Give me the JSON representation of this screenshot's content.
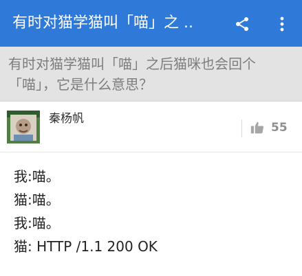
{
  "topbar": {
    "title": "有时对猫学猫叫「喵」之 ..",
    "share_icon": "share-icon",
    "more_icon": "more-vertical-icon",
    "background_color": "#2f7ad8"
  },
  "question": {
    "text": "有时对猫学猫叫「喵」之后猫咪也会回个「喵」，它是什么意思？"
  },
  "answer_meta": {
    "author_name": "秦杨帆",
    "avatar_icon": "avatar",
    "vote_icon": "thumbs-up-icon",
    "vote_count": "55"
  },
  "answer": {
    "lines": [
      "我:喵。",
      "猫:喵。",
      "我:喵。",
      "猫: HTTP /1.1 200 OK"
    ]
  }
}
